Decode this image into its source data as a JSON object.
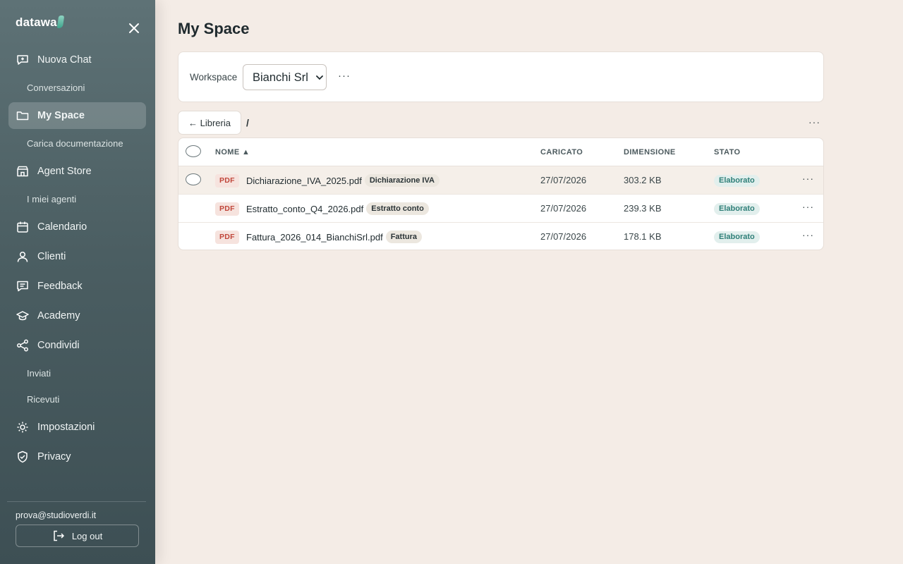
{
  "app": {
    "logo_text": "datawa"
  },
  "sidebar": {
    "nav_new_chat": "Nuova Chat",
    "sub_conversations": "Conversazioni",
    "nav_my_space": "My Space",
    "sub_upload_docs": "Carica documentazione",
    "nav_agent_store": "Agent Store",
    "sub_my_agents": "I miei agenti",
    "nav_calendar": "Calendario",
    "nav_clients": "Clienti",
    "nav_feedback": "Feedback",
    "nav_academy": "Academy",
    "nav_share": "Condividi",
    "sub_sent": "Inviati",
    "sub_received": "Ricevuti",
    "nav_settings": "Impostazioni",
    "nav_privacy": "Privacy",
    "user_email": "prova@studioverdi.it",
    "logout_label": "Log out"
  },
  "main": {
    "title": "My Space",
    "workspace_label": "Workspace",
    "workspace_selected": "Bianchi Srl",
    "more_label": "···",
    "library_button": "← Libreria",
    "breadcrumb_sep": "/",
    "table": {
      "columns": {
        "name": "NOME ▲",
        "uploaded": "CARICATO",
        "size": "DIMENSIONE",
        "status": "STATO"
      },
      "rows": [
        {
          "type": "PDF",
          "name": "Dichiarazione_IVA_2025.pdf",
          "tag": "Dichiarazione IVA",
          "uploaded": "27/07/2026",
          "size": "303.2 KB",
          "status": "Elaborato"
        },
        {
          "type": "PDF",
          "name": "Estratto_conto_Q4_2026.pdf",
          "tag": "Estratto conto",
          "uploaded": "27/07/2026",
          "size": "239.3 KB",
          "status": "Elaborato"
        },
        {
          "type": "PDF",
          "name": "Fattura_2026_014_BianchiSrl.pdf",
          "tag": "Fattura",
          "uploaded": "27/07/2026",
          "size": "178.1 KB",
          "status": "Elaborato"
        }
      ]
    }
  },
  "colors": {
    "sidebar": "#4b5e62",
    "background": "#f4ece6",
    "status_text": "#2f7f78",
    "pdf_badge": "#c0463a"
  }
}
